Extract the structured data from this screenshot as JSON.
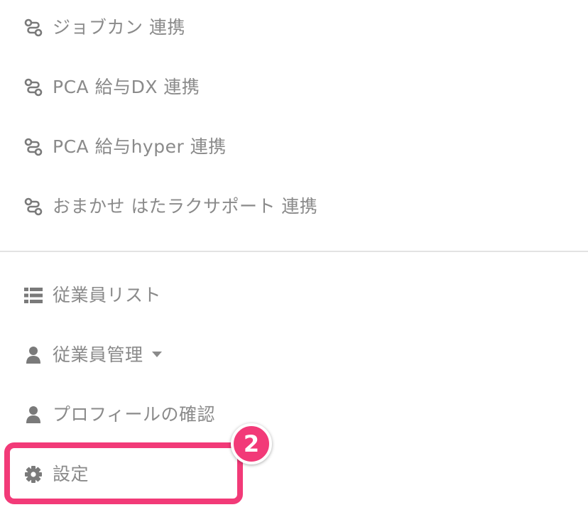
{
  "menu": {
    "integrations": [
      {
        "label": "ジョブカン 連携",
        "icon": "integration-icon"
      },
      {
        "label": "PCA 給与DX 連携",
        "icon": "integration-icon"
      },
      {
        "label": "PCA 給与hyper 連携",
        "icon": "integration-icon"
      },
      {
        "label": "おまかせ はたラクサポート 連携",
        "icon": "integration-icon"
      }
    ],
    "employee_list": {
      "label": "従業員リスト",
      "icon": "list-icon"
    },
    "employee_management": {
      "label": "従業員管理",
      "icon": "user-icon",
      "has_dropdown": true
    },
    "profile_check": {
      "label": "プロフィールの確認",
      "icon": "user-icon"
    },
    "settings": {
      "label": "設定",
      "icon": "gear-icon"
    }
  },
  "annotation": {
    "step_number": "2",
    "highlight_color": "#f23a78"
  },
  "colors": {
    "text": "#8a8a8a",
    "icon": "#7a7a7a",
    "divider": "#e3e3e3"
  }
}
